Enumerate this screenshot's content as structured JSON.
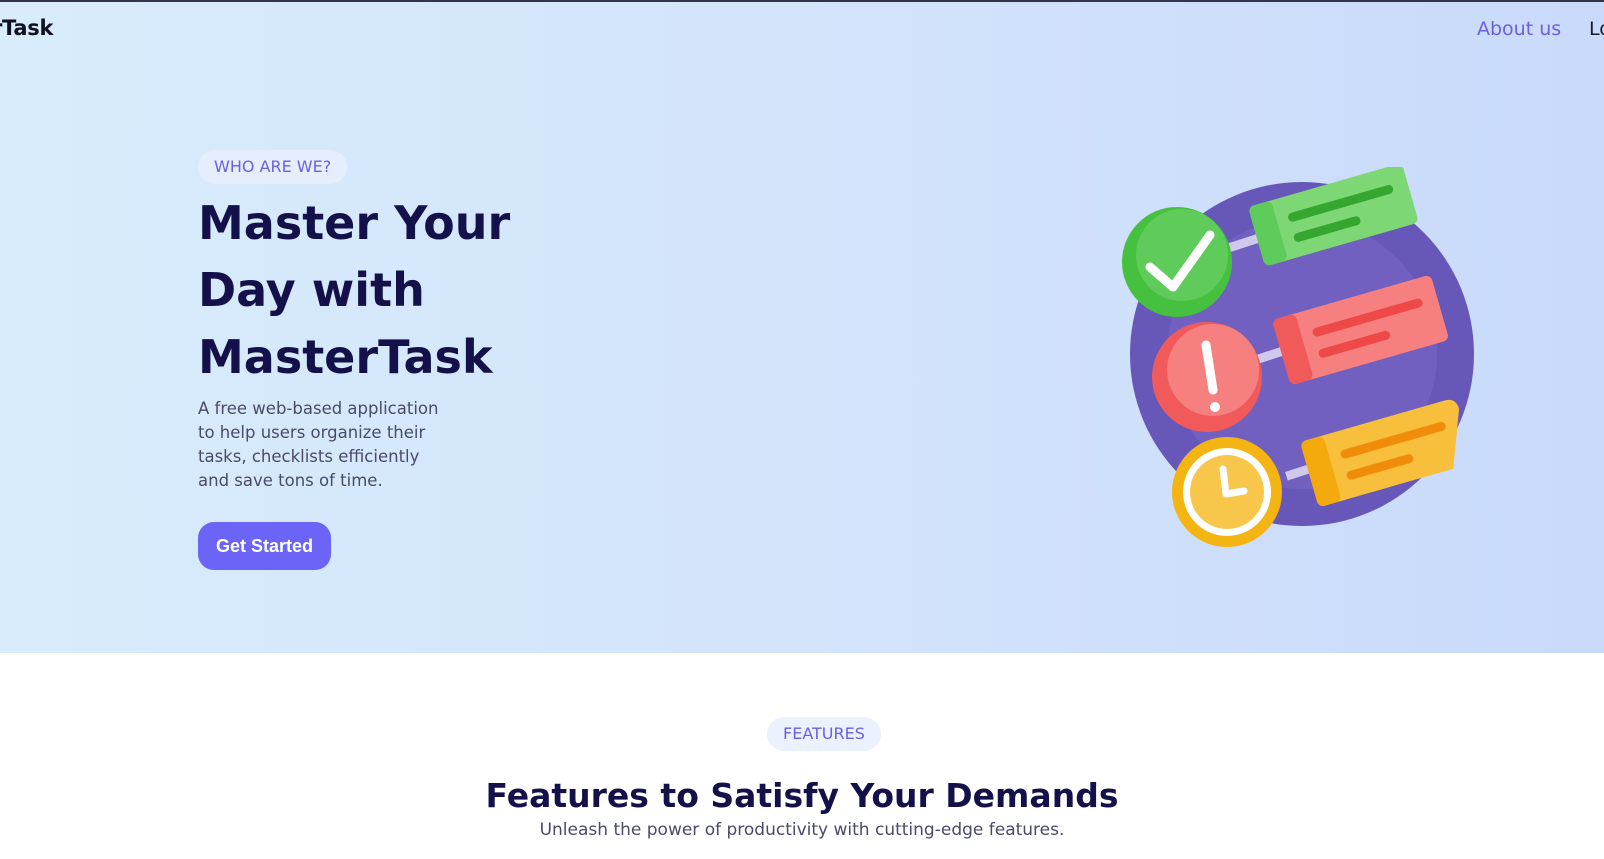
{
  "nav": {
    "brand": "rTask",
    "about": "About us",
    "login": "Lo"
  },
  "hero": {
    "tag": "WHO ARE WE?",
    "title": "Master Your Day with MasterTask",
    "description": "A free web-based application to help users organize their tasks, checklists efficiently and save tons of time.",
    "cta": "Get Started",
    "illustration_icons": [
      "check-icon",
      "exclamation-icon",
      "clock-icon"
    ]
  },
  "features": {
    "tag": "FEATURES",
    "title": "Features to Satisfy Your Demands",
    "subtitle": "Unleash the power of productivity with cutting-edge features."
  },
  "colors": {
    "accent": "#6c63f7",
    "heading": "#13104a",
    "illustration_circle": "#6657b8",
    "task_green": "#5fcb5a",
    "task_red": "#f36b6b",
    "task_yellow": "#f7bf3b"
  }
}
